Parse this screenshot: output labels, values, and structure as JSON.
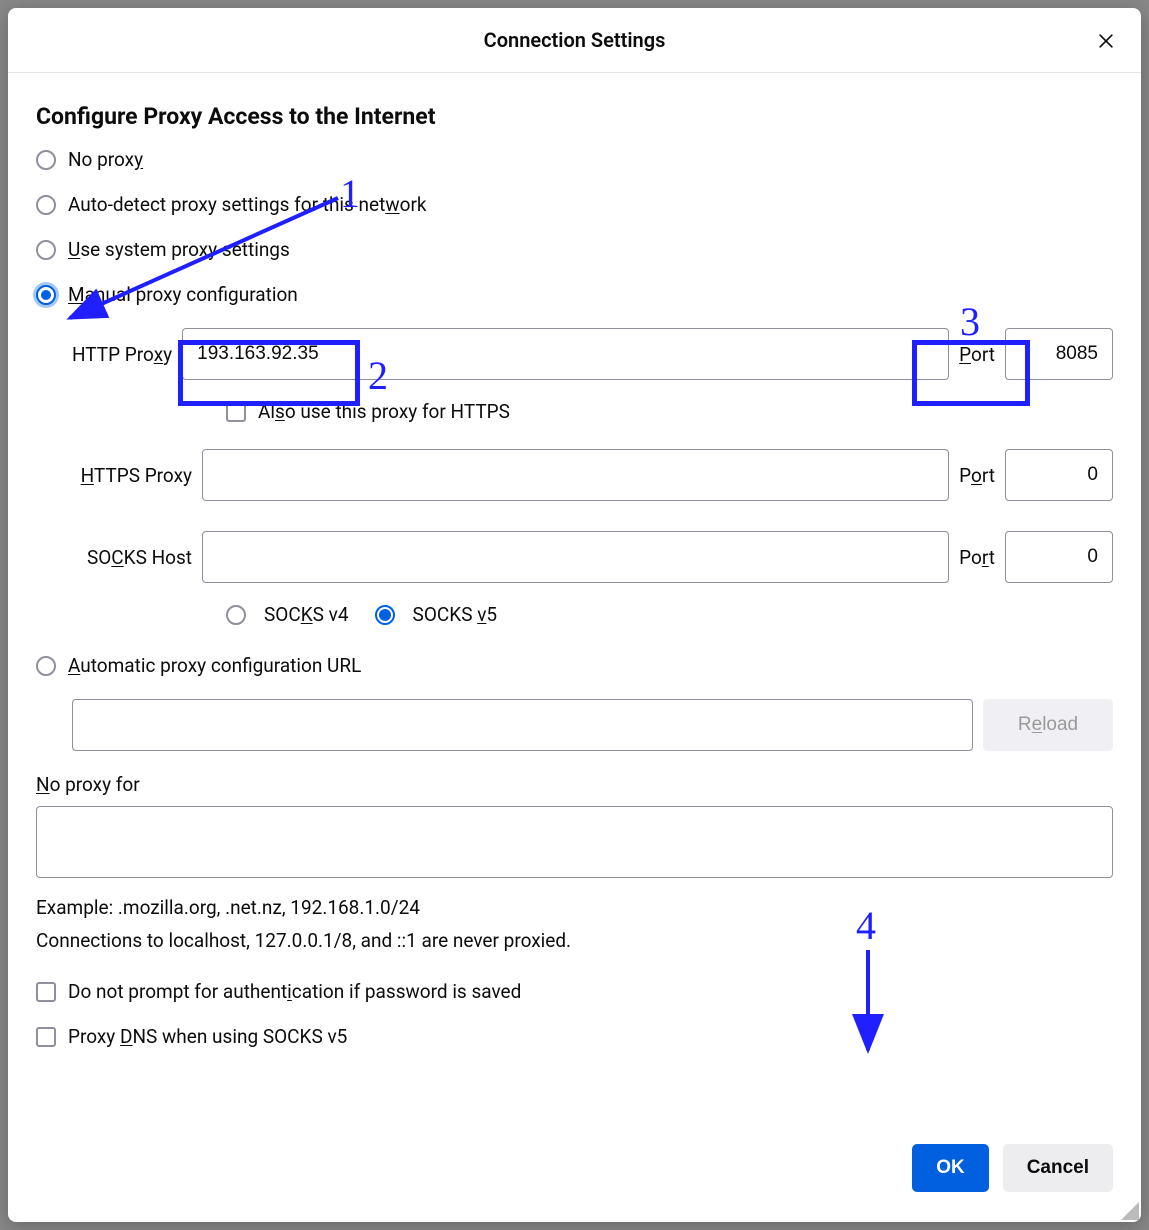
{
  "dialog": {
    "title": "Connection Settings",
    "heading": "Configure Proxy Access to the Internet"
  },
  "proxyMode": {
    "noProxy": "No proxy",
    "autoDetect": "Auto-detect proxy settings for this network",
    "system": "Use system proxy settings",
    "manual": "Manual proxy configuration"
  },
  "fields": {
    "httpProxyLabel": "HTTP Proxy",
    "httpProxyValue": "193.163.92.35",
    "httpPortLabel": "Port",
    "httpPortValue": "8085",
    "alsoHttps": "Also use this proxy for HTTPS",
    "httpsProxyLabel": "HTTPS Proxy",
    "httpsProxyValue": "",
    "httpsPortLabel": "Port",
    "httpsPortValue": "0",
    "socksHostLabel": "SOCKS Host",
    "socksHostValue": "",
    "socksPortLabel": "Port",
    "socksPortValue": "0",
    "socksV4": "SOCKS v4",
    "socksV5": "SOCKS v5",
    "autoUrl": "Automatic proxy configuration URL",
    "autoUrlValue": "",
    "reload": "Reload",
    "noProxyForLabel": "No proxy for",
    "noProxyForValue": "",
    "example": "Example: .mozilla.org, .net.nz, 192.168.1.0/24",
    "localhostNote": "Connections to localhost, 127.0.0.1/8, and ::1 are never proxied.",
    "noPrompt": "Do not prompt for authentication if password is saved",
    "proxyDns": "Proxy DNS when using SOCKS v5"
  },
  "buttons": {
    "ok": "OK",
    "cancel": "Cancel"
  },
  "annotations": {
    "n1": "1",
    "n2": "2",
    "n3": "3",
    "n4": "4"
  }
}
